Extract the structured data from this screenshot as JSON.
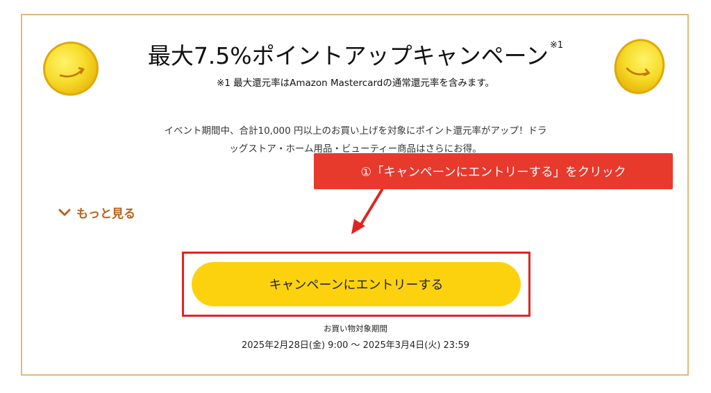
{
  "campaign": {
    "title_main": "最大7.5%ポイントアップキャンペーン",
    "title_note_mark": "※1",
    "footnote": "※1 最大還元率はAmazon Mastercardの通常還元率を含みます。",
    "description_line1": "イベント期間中、合計10,000 円以上のお買い上げを対象にポイント還元率がアップ！ドラ",
    "description_line2": "ッグストア・ホーム用品・ビューティー商品はさらにお得。",
    "more_label": "もっと見る",
    "entry_button_label": "キャンペーンにエントリーする",
    "period_label": "お買い物対象期間",
    "period_dates": "2025年2月28日(金) 9:00 ～ 2025年3月4日(火) 23:59"
  },
  "annotation": {
    "callout_text": "①「キャンペーンにエントリーする」をクリック"
  },
  "colors": {
    "border": "#e2b77a",
    "button": "#fcd20f",
    "more_link": "#b8621a",
    "callout_bg": "#e8392d",
    "highlight": "#e1231f"
  },
  "icons": {
    "coin_left": "amazon-coin-icon",
    "coin_right": "amazon-coin-icon",
    "more": "chevron-down-icon",
    "arrow": "arrow-pointer-icon"
  }
}
